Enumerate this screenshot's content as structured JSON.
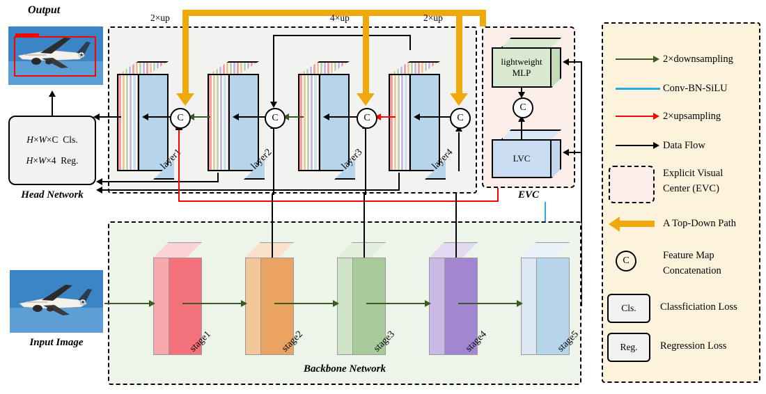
{
  "figure": {
    "output_label": "Output",
    "input_label": "Input Image",
    "head_label": "Head Network",
    "backbone_label": "Backbone Network",
    "evc_label": "EVC"
  },
  "head": {
    "cls_line": "H×W×C  Cls.",
    "reg_line": "H×W×4  Reg."
  },
  "upsample_labels": [
    {
      "id": "up1",
      "text": "2×up"
    },
    {
      "id": "up2",
      "text": "4×up"
    },
    {
      "id": "up3",
      "text": "2×up"
    }
  ],
  "neck_layers": [
    {
      "label": "layer1"
    },
    {
      "label": "layer2"
    },
    {
      "label": "layer3"
    },
    {
      "label": "layer4"
    }
  ],
  "backbone_stages": [
    {
      "label": "stage1",
      "face": "#f2717a",
      "side": "#f7a9ae",
      "top": "#fbd3d6"
    },
    {
      "label": "stage2",
      "face": "#eaa461",
      "side": "#f3c79a",
      "top": "#f9e2c9"
    },
    {
      "label": "stage3",
      "face": "#a8cb9b",
      "side": "#c9e0c0",
      "top": "#e2efdd"
    },
    {
      "label": "stage4",
      "face": "#a286cf",
      "side": "#c9b9e4",
      "top": "#e3daf2"
    },
    {
      "label": "stage5",
      "face": "#b6d4ea",
      "side": "#d7e6f3",
      "top": "#eaf1f8"
    }
  ],
  "evc": {
    "mlp_label": "lightweight\nMLP",
    "mlp_line1": "lightweight",
    "mlp_line2": "MLP",
    "lvc_label": "LVC",
    "concat_symbol": "C"
  },
  "concat_symbol": "C",
  "legend": {
    "items": [
      {
        "icon": "green-arrow-icon",
        "text": "2×downsampling"
      },
      {
        "icon": "blue-line-icon",
        "text": "Conv-BN-SiLU"
      },
      {
        "icon": "red-arrow-icon",
        "text": "2×upsampling"
      },
      {
        "icon": "black-arrow-icon",
        "text": "Data Flow"
      },
      {
        "icon": "dashed-box-icon",
        "text_line1": "Explicit Visual",
        "text_line2": "Center (EVC)"
      },
      {
        "icon": "yellow-arrow-icon",
        "text": "A Top-Down Path"
      },
      {
        "icon": "concat-circle-icon",
        "chip": "C",
        "text_line1": "Feature Map",
        "text_line2": "Concatenation"
      },
      {
        "icon": "cls-chip-icon",
        "chip": "Cls.",
        "text": "Classficiation Loss"
      },
      {
        "icon": "reg-chip-icon",
        "chip": "Reg.",
        "text": "Regression Loss"
      }
    ]
  },
  "colors": {
    "downsampling": "#3c5a22",
    "conv_bn_silu": "#29abe2",
    "upsampling": "#ff0000",
    "data_flow": "#000000",
    "top_down_path": "#efa90d",
    "evc_bg": "#fbeee9",
    "neck_bg": "#f2f2f0",
    "backbone_bg": "#edf4e9",
    "legend_bg": "#fdf3dc"
  }
}
